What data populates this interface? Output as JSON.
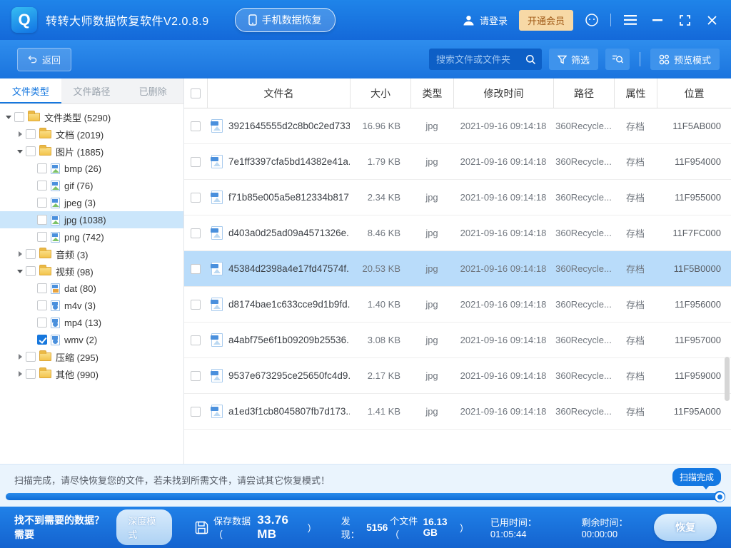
{
  "titlebar": {
    "app_title": "转转大师数据恢复软件V2.0.8.9",
    "phone_button": "手机数据恢复",
    "login": "请登录",
    "vip_button": "开通会员",
    "icons": [
      "app-logo",
      "phone-icon",
      "user-icon",
      "customer-service-icon",
      "menu-icon",
      "minimize-icon",
      "maximize-icon",
      "close-icon"
    ]
  },
  "toolbar": {
    "back": "返回",
    "search_placeholder": "搜索文件或文件夹",
    "filter": "筛选",
    "preview": "预览模式",
    "icons": [
      "back-arrow-icon",
      "search-icon",
      "filter-funnel-icon",
      "search-in-results-icon",
      "preview-grid-icon"
    ]
  },
  "sidebar": {
    "tabs": [
      {
        "label": "文件类型",
        "active": true
      },
      {
        "label": "文件路径",
        "active": false
      },
      {
        "label": "已删除",
        "active": false
      }
    ],
    "tree": [
      {
        "label": "文件类型 (5290)",
        "icon": "folder-icon",
        "level": 0,
        "expanded": true,
        "checked": false
      },
      {
        "label": "文档 (2019)",
        "icon": "folder-icon",
        "level": 1,
        "expanded": false,
        "checked": false
      },
      {
        "label": "图片 (1885)",
        "icon": "folder-icon",
        "level": 1,
        "expanded": true,
        "checked": false
      },
      {
        "label": "bmp (26)",
        "icon": "image-file-icon",
        "level": 2,
        "checked": false
      },
      {
        "label": "gif (76)",
        "icon": "image-file-icon",
        "level": 2,
        "checked": false
      },
      {
        "label": "jpeg (3)",
        "icon": "image-file-icon",
        "level": 2,
        "checked": false
      },
      {
        "label": "jpg (1038)",
        "icon": "image-file-icon",
        "level": 2,
        "checked": false,
        "selected": true
      },
      {
        "label": "png (742)",
        "icon": "image-file-icon",
        "level": 2,
        "checked": false
      },
      {
        "label": "音频 (3)",
        "icon": "folder-icon",
        "level": 1,
        "expanded": false,
        "checked": false
      },
      {
        "label": "视频 (98)",
        "icon": "folder-icon",
        "level": 1,
        "expanded": true,
        "checked": false
      },
      {
        "label": "dat (80)",
        "icon": "dat-file-icon",
        "level": 2,
        "checked": false
      },
      {
        "label": "m4v (3)",
        "icon": "video-file-icon",
        "level": 2,
        "checked": false
      },
      {
        "label": "mp4 (13)",
        "icon": "video-file-icon",
        "level": 2,
        "checked": false
      },
      {
        "label": "wmv (2)",
        "icon": "video-file-icon",
        "level": 2,
        "checked": true
      },
      {
        "label": "压缩 (295)",
        "icon": "folder-icon",
        "level": 1,
        "expanded": false,
        "checked": false
      },
      {
        "label": "其他 (990)",
        "icon": "folder-icon",
        "level": 1,
        "expanded": false,
        "checked": false
      }
    ]
  },
  "table": {
    "columns": {
      "name": "文件名",
      "size": "大小",
      "type": "类型",
      "modified": "修改时间",
      "path": "路径",
      "attr": "属性",
      "location": "位置"
    },
    "rows": [
      {
        "name": "3921645555d2c8b0c2ed733...",
        "size": "16.96 KB",
        "type": "jpg",
        "modified": "2021-09-16 09:14:18",
        "path": "360Recycle...",
        "attr": "存档",
        "location": "11F5AB000",
        "selected": false
      },
      {
        "name": "7e1ff3397cfa5bd14382e41a...",
        "size": "1.79 KB",
        "type": "jpg",
        "modified": "2021-09-16 09:14:18",
        "path": "360Recycle...",
        "attr": "存档",
        "location": "11F954000",
        "selected": false
      },
      {
        "name": "f71b85e005a5e812334b817...",
        "size": "2.34 KB",
        "type": "jpg",
        "modified": "2021-09-16 09:14:18",
        "path": "360Recycle...",
        "attr": "存档",
        "location": "11F955000",
        "selected": false
      },
      {
        "name": "d403a0d25ad09a4571326e...",
        "size": "8.46 KB",
        "type": "jpg",
        "modified": "2021-09-16 09:14:18",
        "path": "360Recycle...",
        "attr": "存档",
        "location": "11F7FC000",
        "selected": false
      },
      {
        "name": "45384d2398a4e17fd47574f...",
        "size": "20.53 KB",
        "type": "jpg",
        "modified": "2021-09-16 09:14:18",
        "path": "360Recycle...",
        "attr": "存档",
        "location": "11F5B0000",
        "selected": true
      },
      {
        "name": "d8174bae1c633cce9d1b9fd...",
        "size": "1.40 KB",
        "type": "jpg",
        "modified": "2021-09-16 09:14:18",
        "path": "360Recycle...",
        "attr": "存档",
        "location": "11F956000",
        "selected": false
      },
      {
        "name": "a4abf75e6f1b09209b25536...",
        "size": "3.08 KB",
        "type": "jpg",
        "modified": "2021-09-16 09:14:18",
        "path": "360Recycle...",
        "attr": "存档",
        "location": "11F957000",
        "selected": false
      },
      {
        "name": "9537e673295ce25650fc4d9...",
        "size": "2.17 KB",
        "type": "jpg",
        "modified": "2021-09-16 09:14:18",
        "path": "360Recycle...",
        "attr": "存档",
        "location": "11F959000",
        "selected": false
      },
      {
        "name": "a1ed3f1cb8045807fb7d173...",
        "size": "1.41 KB",
        "type": "jpg",
        "modified": "2021-09-16 09:14:18",
        "path": "360Recycle...",
        "attr": "存档",
        "location": "11F95A000",
        "selected": false
      }
    ]
  },
  "statusbar": {
    "message": "扫描完成，请尽快恢复您的文件，若未找到所需文件，请尝试其它恢复模式！",
    "badge": "扫描完成",
    "progress_percent": 100
  },
  "footer": {
    "prompt": "找不到需要的数据？需要",
    "deep_mode": "深度模式",
    "save_label": "保存数据（",
    "save_size": "33.76 MB",
    "save_close": "）",
    "found_label": "发现：",
    "found_count": "5156",
    "found_unit": "个文件（",
    "found_size": "16.13 GB",
    "found_close": "）",
    "elapsed": "已用时间：01:05:44",
    "remaining": "剩余时间：00:00:00",
    "recover": "恢复"
  },
  "colors": {
    "accent": "#1577df",
    "titlebar_blue": "#1c7ee6",
    "selected_row": "#b9dcfa",
    "vip_bg": "#f7d9a6",
    "vip_text": "#a05a17",
    "status_strip": "#eaf4fd"
  }
}
